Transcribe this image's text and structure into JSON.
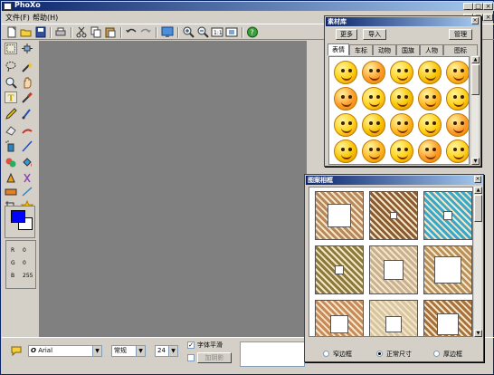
{
  "window": {
    "title": "PhoXo"
  },
  "menu": {
    "file": "文件(F)",
    "help": "帮助(H)"
  },
  "statusbar": {
    "font_name": "Arial",
    "font_style": "常规",
    "font_size": "24",
    "smooth_label": "字体平滑",
    "smooth_checked": "✓",
    "add_shadow": "加阴影"
  },
  "color": {
    "r_label": "R",
    "r": "0",
    "g_label": "G",
    "g": "0",
    "b_label": "B",
    "b": "255",
    "fg": "#0000ff",
    "bg": "#ffffff"
  },
  "library": {
    "title": "素材库",
    "more": "更多",
    "import": "导入",
    "manage": "管理",
    "tabs": [
      "表情",
      "车标",
      "动物",
      "国旗",
      "人物",
      "图标"
    ],
    "active_tab": 0
  },
  "frames": {
    "title": "图案相框",
    "options": [
      "窄边框",
      "正常尺寸",
      "厚边框"
    ],
    "selected": 1
  },
  "icons": {
    "toolbar": [
      "new-icon",
      "open-icon",
      "save-icon",
      "print-icon",
      "cut-icon",
      "copy-icon",
      "paste-icon",
      "undo-icon",
      "redo-icon",
      "screen-capture-icon",
      "zoom-in-icon",
      "zoom-out-icon",
      "actual-size-icon",
      "fit-window-icon",
      "help-icon"
    ],
    "tools": [
      "select-rect-icon",
      "move-icon",
      "lasso-icon",
      "magic-wand-icon",
      "zoom-icon",
      "hand-icon",
      "text-icon",
      "eyedropper-icon",
      "pencil-icon",
      "brush-icon",
      "eraser-icon",
      "smudge-icon",
      "spray-icon",
      "line-icon",
      "clone-icon",
      "fill-icon",
      "sharpen-icon",
      "gradient-icon",
      "rect-icon",
      "stamp-icon",
      "crop-icon",
      "star-icon"
    ]
  }
}
